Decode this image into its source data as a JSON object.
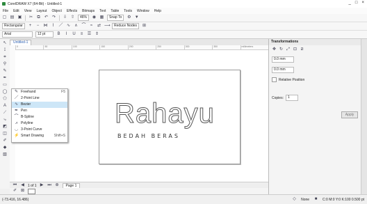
{
  "window": {
    "title": "CorelDRAW X7 (64-Bit) - Untitled-1",
    "controls": [
      "_",
      "□",
      "×"
    ]
  },
  "menu": [
    "File",
    "Edit",
    "View",
    "Layout",
    "Object",
    "Effects",
    "Bitmaps",
    "Text",
    "Table",
    "Tools",
    "Window",
    "Help"
  ],
  "toolbar": {
    "zoom": "46%",
    "snap_to": "Snap To",
    "reduce_nodes": "Reduce Nodes"
  },
  "property_bar": {
    "selector": "Rectangular"
  },
  "text_bar": {
    "font": "Arial",
    "size": "12 pt"
  },
  "tab": {
    "label": "Untitled-1"
  },
  "ruler_ticks": [
    "0",
    "50",
    "100",
    "150",
    "200",
    "250",
    "300",
    "350",
    "millimeters"
  ],
  "flyout": [
    {
      "label": "Freehand",
      "shortcut": "F5",
      "icon": "freehand-icon"
    },
    {
      "label": "2-Point Line",
      "shortcut": "",
      "icon": "line-icon"
    },
    {
      "label": "Bezier",
      "shortcut": "",
      "icon": "bezier-icon",
      "selected": true
    },
    {
      "label": "Pen",
      "shortcut": "",
      "icon": "pen-icon"
    },
    {
      "label": "B-Spline",
      "shortcut": "",
      "icon": "bspline-icon"
    },
    {
      "label": "Polyline",
      "shortcut": "",
      "icon": "polyline-icon"
    },
    {
      "label": "3-Point Curve",
      "shortcut": "",
      "icon": "curve-icon"
    },
    {
      "label": "Smart Drawing",
      "shortcut": "Shift+S",
      "icon": "smart-drawing-icon"
    }
  ],
  "artwork": {
    "logo": "Rahayu",
    "subtitle": "BEDAH BERAS"
  },
  "docnav": {
    "page_count": "1 of 1",
    "page_tab": "Page 1"
  },
  "docker": {
    "title": "Transformations",
    "x": "0.0 mm",
    "y": "0.0 mm",
    "relative_position": "Relative Position",
    "copies_label": "Copies:",
    "copies_value": "1",
    "apply": "Apply"
  },
  "status": {
    "coords": "(-73.416, 16.486)",
    "fill": "None",
    "color_info": "C:0 M:0 Y:0 K:100 0.500 pt"
  }
}
